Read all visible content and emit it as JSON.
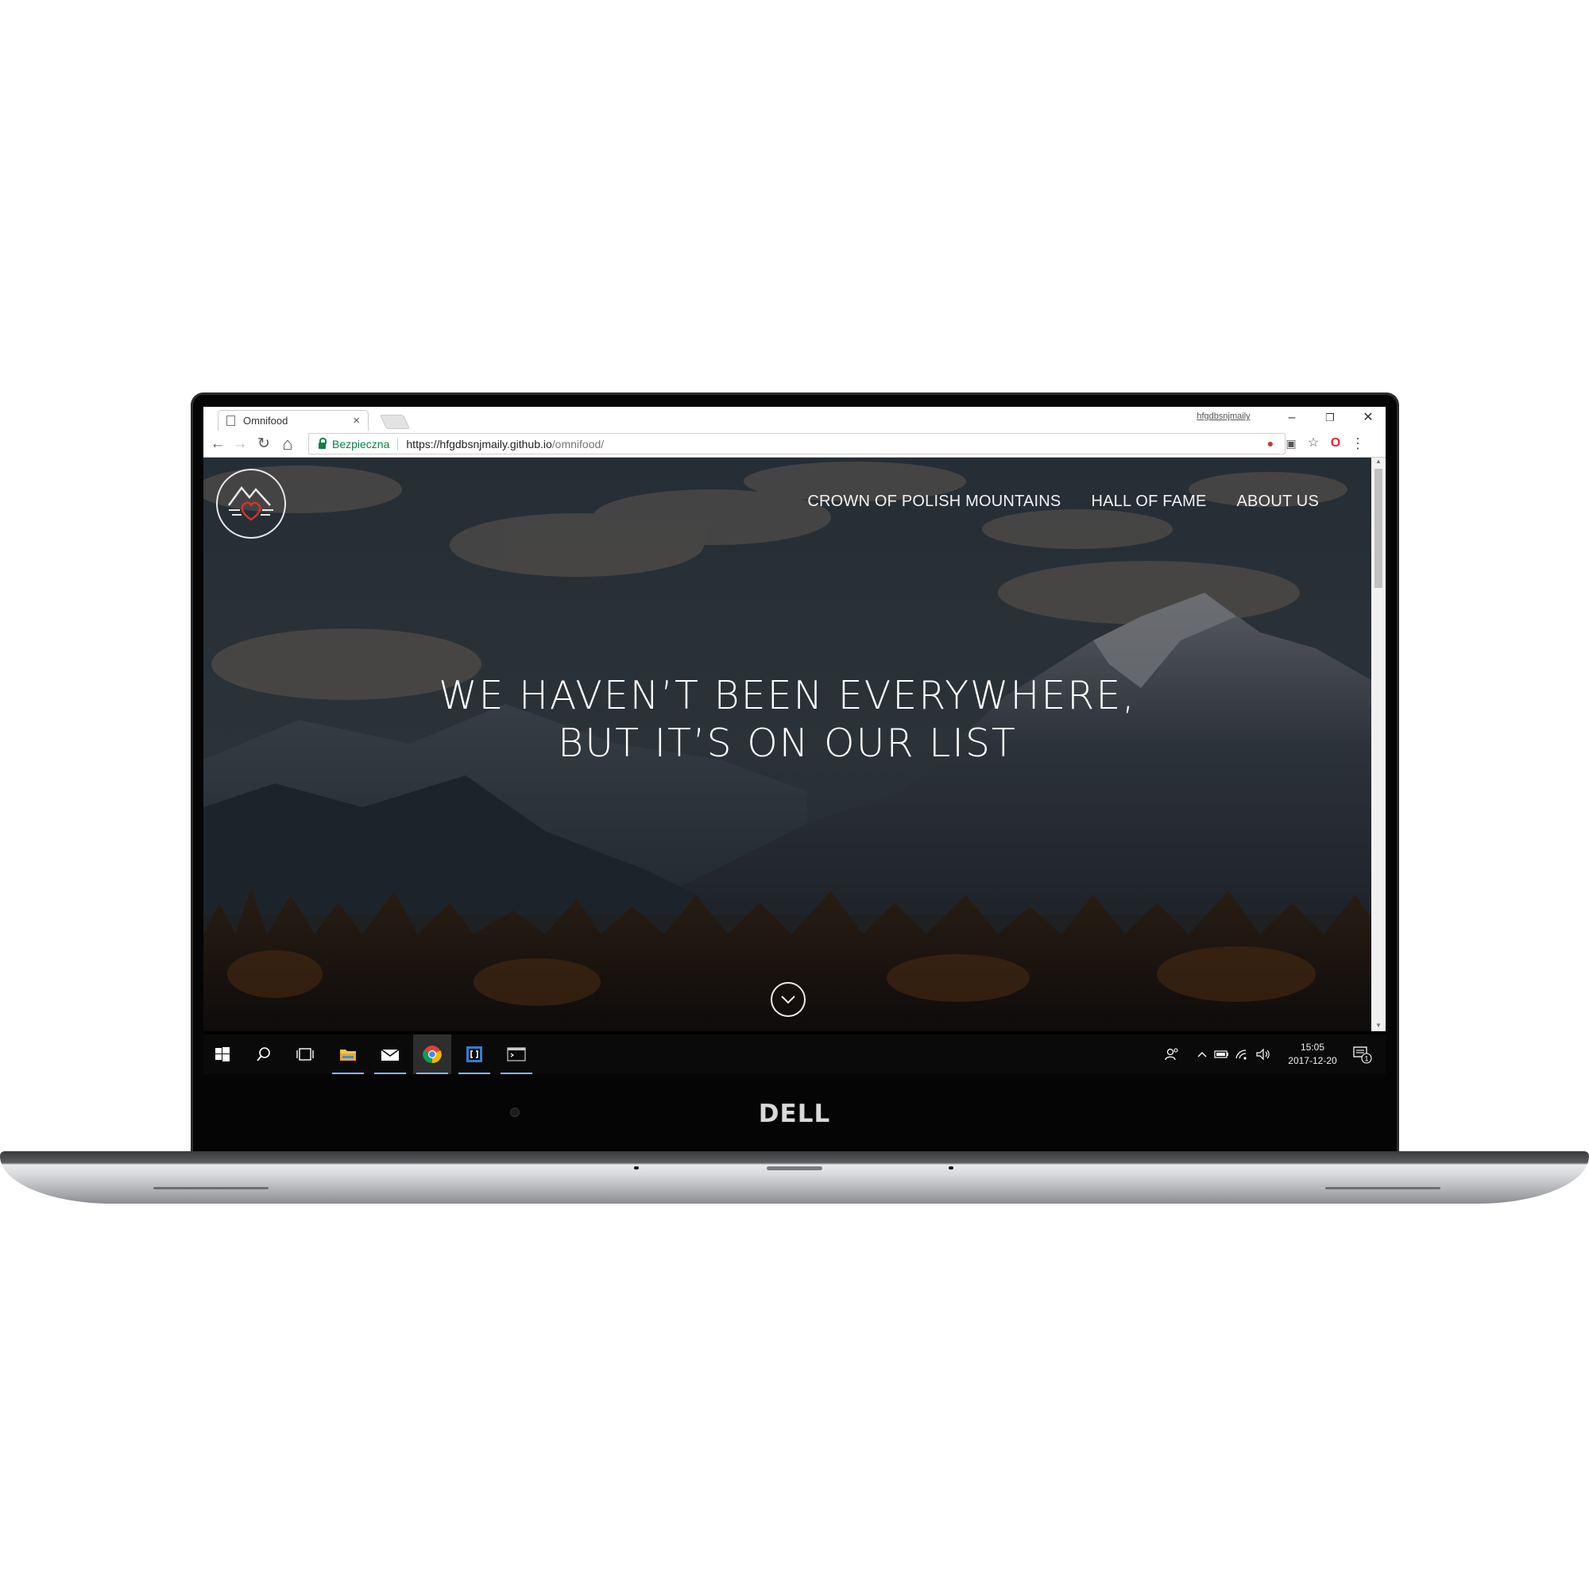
{
  "browser": {
    "tab_title": "Omnifood",
    "tab_close": "×",
    "profile_name": "hfgdbsnjmaily",
    "window_controls": {
      "minimize": "–",
      "restore": "❐",
      "close": "✕"
    },
    "nav": {
      "back": "←",
      "forward": "→",
      "reload": "↻",
      "home": "⌂"
    },
    "security_label": "Bezpieczna",
    "url_main": "https://hfgdbsnjmaily.github.io",
    "url_path": "/omnifood/",
    "extensions": [
      "adblock-icon",
      "translate-icon",
      "bookmark-star-icon",
      "opera-icon",
      "menu-dots-icon"
    ]
  },
  "site": {
    "nav_items": [
      "CROWN OF POLISH MOUNTAINS",
      "HALL OF FAME",
      "ABOUT US"
    ],
    "hero_line1": "WE HAVEN’T BEEN EVERYWHERE,",
    "hero_line2": "BUT IT’S ON OUR LIST",
    "colors": {
      "accent_heart": "#d8322b",
      "overlay": "rgba(0,0,0,0.42)"
    }
  },
  "taskbar": {
    "apps": [
      "start-icon",
      "search-icon",
      "task-view-icon",
      "file-explorer-icon",
      "mail-icon",
      "chrome-icon",
      "brackets-icon",
      "terminal-icon"
    ],
    "time": "15:05",
    "date": "2017-12-20",
    "notification_count": "1"
  },
  "device": {
    "brand": "DELL"
  }
}
